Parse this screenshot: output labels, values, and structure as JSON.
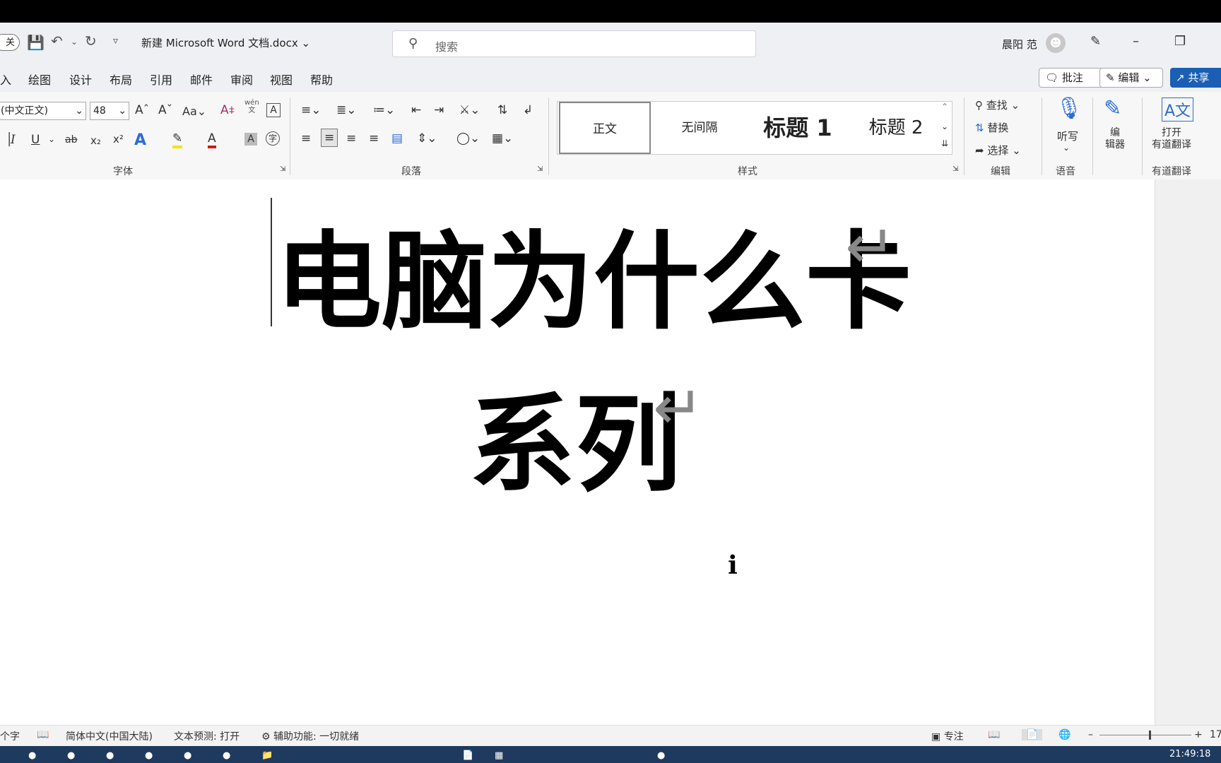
{
  "titlebar": {
    "autosave_toggle": "关",
    "doc_title": "新建 Microsoft Word 文档.docx",
    "search_placeholder": "搜索",
    "user_name": "晨阳 范"
  },
  "tabs": [
    "入",
    "绘图",
    "设计",
    "布局",
    "引用",
    "邮件",
    "审阅",
    "视图",
    "帮助"
  ],
  "actions": {
    "comment": "批注",
    "edit": "编辑",
    "share": "共享"
  },
  "ribbon": {
    "font_name": "(中文正文)",
    "font_size": "48",
    "font_group": "字体",
    "para_group": "段落",
    "styles_group": "样式",
    "styles": [
      "正文",
      "无间隔",
      "标题 1",
      "标题 2"
    ],
    "edit_group": "编辑",
    "find": "查找",
    "replace": "替换",
    "select": "选择",
    "voice_group": "语音",
    "dictate": "听写",
    "editor_label": "编\n辑器",
    "youdao_label": "打开\n有道翻译",
    "youdao_group": "有道翻译",
    "wen": "wén\n文"
  },
  "document": {
    "line1": "电脑为什么卡",
    "line2": "系列"
  },
  "status": {
    "word_count": "个字",
    "language": "简体中文(中国大陆)",
    "prediction": "文本预测: 打开",
    "accessibility": "辅助功能: 一切就绪",
    "focus": "专注",
    "zoom": "17"
  },
  "taskbar": {
    "clock": "21:49:18"
  }
}
